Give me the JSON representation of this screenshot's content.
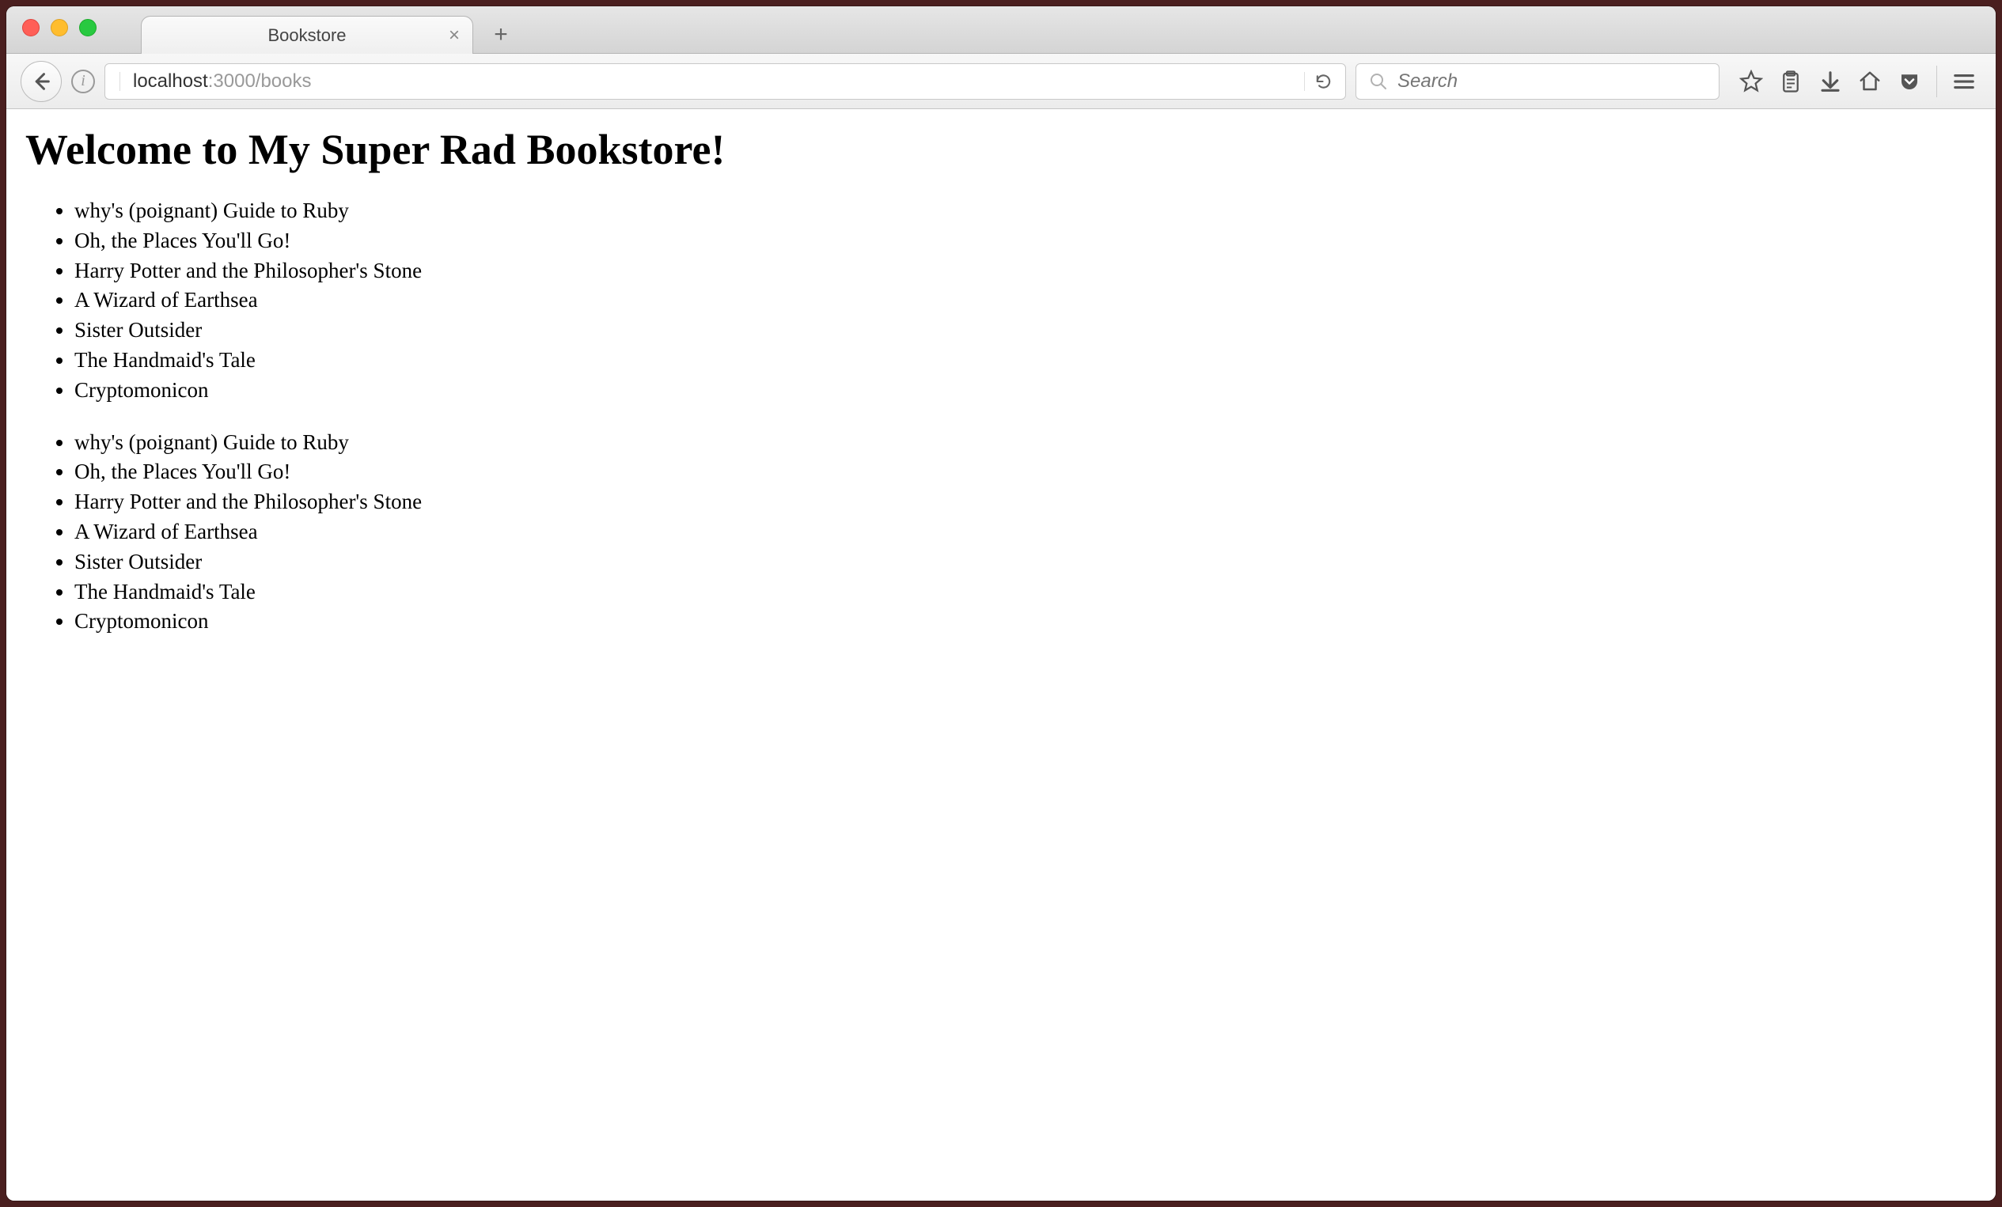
{
  "window": {
    "tab_title": "Bookstore"
  },
  "navbar": {
    "url_host": "localhost",
    "url_port_path": ":3000/books",
    "search_placeholder": "Search"
  },
  "page": {
    "heading": "Welcome to My Super Rad Bookstore!",
    "list1": [
      "why's (poignant) Guide to Ruby",
      "Oh, the Places You'll Go!",
      "Harry Potter and the Philosopher's Stone",
      "A Wizard of Earthsea",
      "Sister Outsider",
      "The Handmaid's Tale",
      "Cryptomonicon"
    ],
    "list2": [
      "why's (poignant) Guide to Ruby",
      "Oh, the Places You'll Go!",
      "Harry Potter and the Philosopher's Stone",
      "A Wizard of Earthsea",
      "Sister Outsider",
      "The Handmaid's Tale",
      "Cryptomonicon"
    ]
  }
}
